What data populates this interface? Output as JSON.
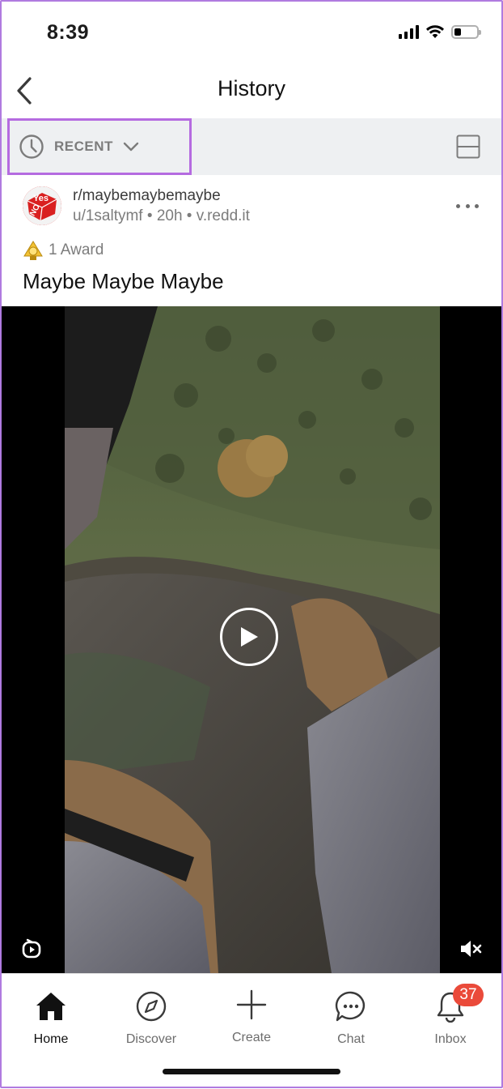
{
  "status_bar": {
    "time": "8:39",
    "battery_level": 0.3
  },
  "header": {
    "title": "History"
  },
  "sort_bar": {
    "sort_label": "RECENT"
  },
  "post": {
    "subreddit": "r/maybemaybemaybe",
    "author": "u/1saltymf",
    "age": "20h",
    "domain": "v.redd.it",
    "award_label": "1 Award",
    "title": "Maybe Maybe Maybe",
    "avatar_text_top": "Yes",
    "avatar_text_side": "NO"
  },
  "tabs": [
    {
      "label": "Home",
      "icon": "home-icon",
      "active": true
    },
    {
      "label": "Discover",
      "icon": "compass-icon",
      "active": false
    },
    {
      "label": "Create",
      "icon": "plus-icon",
      "active": false
    },
    {
      "label": "Chat",
      "icon": "chat-icon",
      "active": false
    },
    {
      "label": "Inbox",
      "icon": "bell-icon",
      "active": false,
      "badge": "37"
    }
  ],
  "colors": {
    "accent_outline": "#b56be0",
    "badge": "#ea4a3a"
  }
}
